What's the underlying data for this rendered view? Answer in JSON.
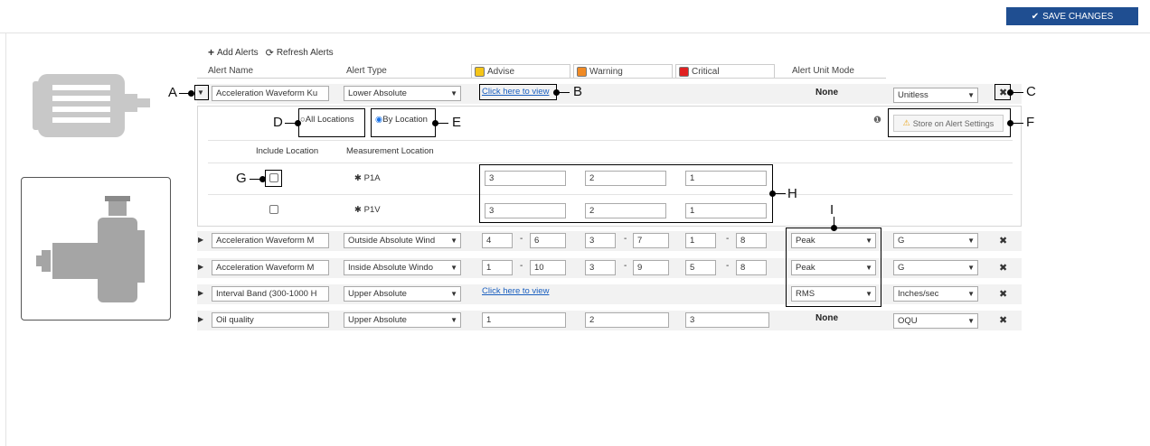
{
  "header": {
    "save_label": "SAVE CHANGES"
  },
  "toolbar": {
    "add_label": "Add Alerts",
    "refresh_label": "Refresh Alerts"
  },
  "columns": {
    "name": "Alert Name",
    "type": "Alert Type",
    "advise": "Advise",
    "warning": "Warning",
    "critical": "Critical",
    "unit_mode": "Alert Unit Mode"
  },
  "colors": {
    "advise": "#f5c518",
    "warning": "#f08a24",
    "critical": "#e02020",
    "save": "#1f4e91",
    "link": "#1a5fbf"
  },
  "row1": {
    "name": "Acceleration Waveform Ku",
    "type": "Lower Absolute",
    "link": "Click here to view",
    "unit_mode": "None",
    "unit": "Unitless"
  },
  "location": {
    "all_label": "All Locations",
    "by_label": "By Location",
    "store_label": "Store on Alert Settings",
    "col_include": "Include Location",
    "col_measure": "Measurement Location",
    "p1": {
      "name": "P1A",
      "advise": "3",
      "warning": "2",
      "critical": "1"
    },
    "p2": {
      "name": "P1V",
      "advise": "3",
      "warning": "2",
      "critical": "1"
    }
  },
  "rows": [
    {
      "name": "Acceleration Waveform M",
      "type": "Outside Absolute Wind",
      "a1": "4",
      "a2": "6",
      "w1": "3",
      "w2": "7",
      "c1": "1",
      "c2": "8",
      "mode": "Peak",
      "unit": "G"
    },
    {
      "name": "Acceleration Waveform M",
      "type": "Inside Absolute Windo",
      "a1": "1",
      "a2": "10",
      "w1": "3",
      "w2": "9",
      "c1": "5",
      "c2": "8",
      "mode": "Peak",
      "unit": "G"
    },
    {
      "name": "Interval Band (300-1000 H",
      "type": "Upper Absolute",
      "link": "Click here to view",
      "mode": "RMS",
      "unit": "Inches/sec"
    },
    {
      "name": "Oil quality",
      "type": "Upper Absolute",
      "a": "1",
      "w": "2",
      "c": "3",
      "mode": "None",
      "unit": "OQU"
    }
  ],
  "callouts": {
    "A": "A",
    "B": "B",
    "C": "C",
    "D": "D",
    "E": "E",
    "F": "F",
    "G": "G",
    "H": "H",
    "I": "I"
  },
  "dash": "-",
  "icons": [
    "check-icon",
    "plus-icon",
    "refresh-icon",
    "chevron-down-icon",
    "caret-right-icon",
    "close-icon",
    "info-icon",
    "warning-icon",
    "asterisk-icon",
    "motor-icon",
    "pump-icon"
  ]
}
